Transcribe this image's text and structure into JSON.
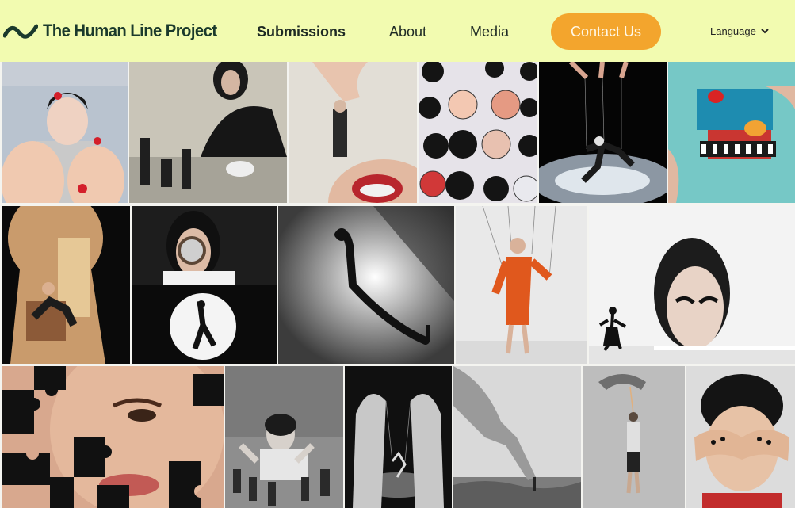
{
  "header": {
    "logo_text": "The Human Line Project",
    "nav": {
      "submissions": "Submissions",
      "about": "About",
      "media": "Media"
    },
    "contact_label": "Contact Us",
    "language_label": "Language"
  },
  "colors": {
    "header_bg": "#f2fbb0",
    "brand_dark": "#1b3a2c",
    "accent_orange": "#f3a52d"
  },
  "icons": {
    "logo": "wave-logo-icon",
    "language_toggle": "chevron-down-icon"
  }
}
